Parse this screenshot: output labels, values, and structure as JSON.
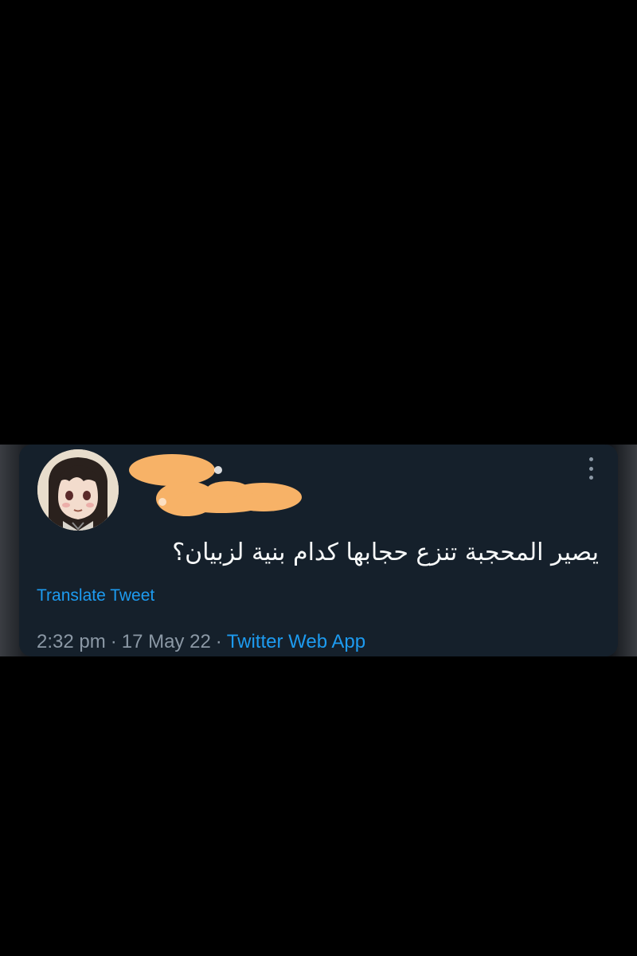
{
  "tweet": {
    "text": "يصير المحجبة تنزع حجابها كدام بنية لزبيان؟",
    "translate_label": "Translate Tweet",
    "time": "2:32 pm",
    "separator": "·",
    "date": "17 May 22",
    "source": "Twitter Web App",
    "more_icon": "more-vertical-icon",
    "username_redacted": true
  },
  "colors": {
    "background": "#000000",
    "card": "#15202b",
    "text_primary": "#f7f9f9",
    "text_secondary": "#8b98a5",
    "link": "#1d9bf0",
    "redaction": "#f7b267"
  }
}
